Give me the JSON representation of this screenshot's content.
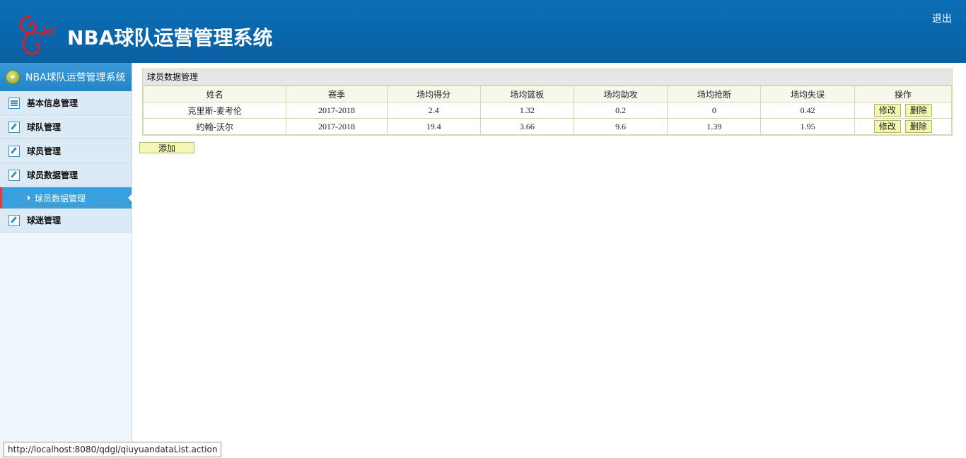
{
  "header": {
    "app_title": "NBA球队运营管理系统",
    "logout_label": "退出"
  },
  "sidebar": {
    "head_label": "NBA球队运营管理系统",
    "items": [
      {
        "label": "基本信息管理",
        "icon": "list-icon"
      },
      {
        "label": "球队管理",
        "icon": "edit-icon"
      },
      {
        "label": "球员管理",
        "icon": "edit-icon"
      },
      {
        "label": "球员数据管理",
        "icon": "edit-icon"
      },
      {
        "label": "球迷管理",
        "icon": "edit-icon"
      }
    ],
    "active_sub": "球员数据管理"
  },
  "panel": {
    "title": "球员数据管理",
    "columns": [
      "姓名",
      "赛季",
      "场均得分",
      "场均篮板",
      "场均助攻",
      "场均抢断",
      "场均失误",
      "操作"
    ],
    "rows": [
      {
        "name": "克里斯-麦考伦",
        "season": "2017-2018",
        "pts": "2.4",
        "reb": "1.32",
        "ast": "0.2",
        "stl": "0",
        "tov": "0.42"
      },
      {
        "name": "约翰-沃尔",
        "season": "2017-2018",
        "pts": "19.4",
        "reb": "3.66",
        "ast": "9.6",
        "stl": "1.39",
        "tov": "1.95"
      }
    ],
    "edit_label": "修改",
    "delete_label": "删除",
    "add_label": "添加"
  },
  "statusbar": {
    "url": "http://localhost:8080/qdgl/qiuyuandataList.action"
  },
  "colors": {
    "header_bg": "#0a66ab",
    "sidebar_active": "#3aa0dd",
    "button_bg": "#f4f7b0"
  }
}
